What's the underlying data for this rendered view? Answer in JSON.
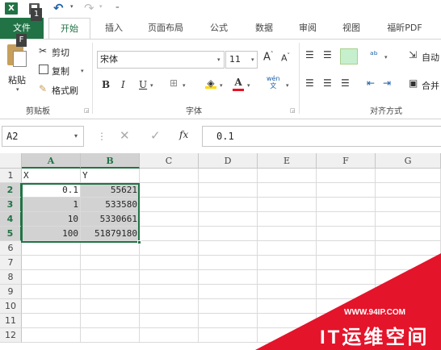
{
  "qat": {
    "keytip_1": "1",
    "keytip_f": "F"
  },
  "tabs": [
    "文件",
    "开始",
    "插入",
    "页面布局",
    "公式",
    "数据",
    "审阅",
    "视图",
    "福昕PDF"
  ],
  "ribbon": {
    "clipboard": {
      "paste": "粘贴",
      "cut": "剪切",
      "copy": "复制",
      "format_painter": "格式刷",
      "group": "剪贴板"
    },
    "font": {
      "name": "宋体",
      "size": "11",
      "bold": "B",
      "italic": "I",
      "underline": "U",
      "group": "字体",
      "grow": "A",
      "shrink": "A",
      "phonetic": "wén"
    },
    "alignment": {
      "wrap": "自动",
      "merge": "合并",
      "group": "对齐方式"
    }
  },
  "formula_bar": {
    "name_box": "A2",
    "formula": "0.1",
    "fx": "fx"
  },
  "grid": {
    "columns": [
      "A",
      "B",
      "C",
      "D",
      "E",
      "F",
      "G"
    ],
    "selected_columns": [
      "A",
      "B"
    ],
    "rows": [
      "1",
      "2",
      "3",
      "4",
      "5",
      "6",
      "7",
      "8",
      "9",
      "10",
      "11",
      "12"
    ],
    "selected_rows": [
      "2",
      "3",
      "4",
      "5"
    ],
    "cells": [
      [
        "X",
        "Y"
      ],
      [
        "0.1",
        "55621"
      ],
      [
        "1",
        "533580"
      ],
      [
        "10",
        "5330661"
      ],
      [
        "100",
        "51879180"
      ]
    ]
  },
  "watermark": {
    "url": "WWW.94IP.COM",
    "brand": "IT运维空间"
  },
  "colors": {
    "excel_green": "#217346",
    "selection_gray": "#d2d2d2",
    "watermark_red": "#e4142a"
  }
}
